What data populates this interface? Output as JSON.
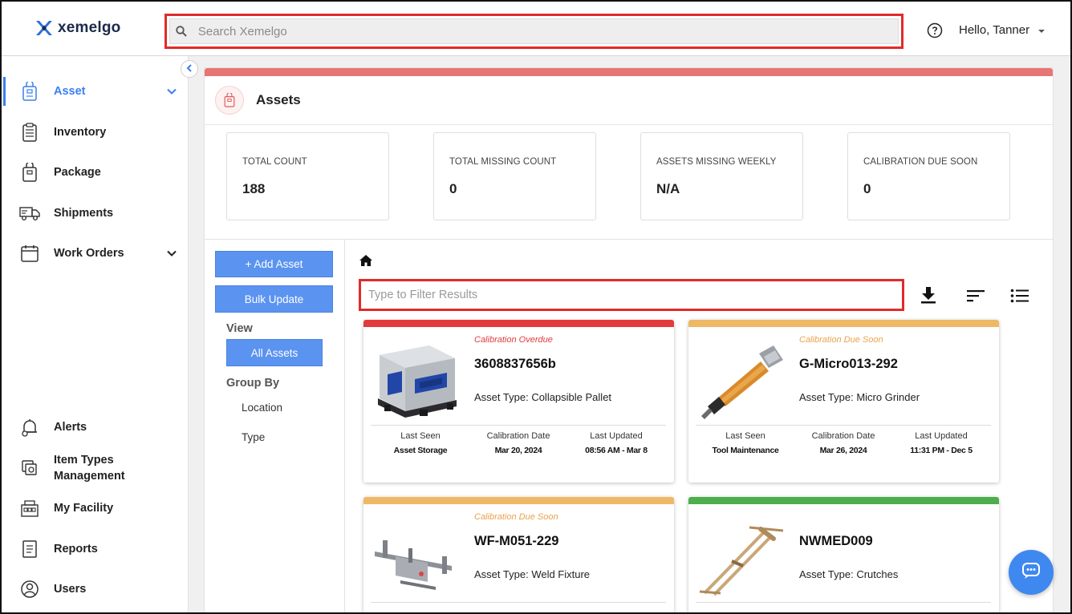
{
  "brand": {
    "name": "xemelgo"
  },
  "search": {
    "placeholder": "Search Xemelgo"
  },
  "user": {
    "greeting": "Hello, Tanner"
  },
  "sidebar": {
    "items": [
      {
        "label": "Asset",
        "icon": "asset-tag-icon",
        "active": true,
        "expandable": true
      },
      {
        "label": "Inventory",
        "icon": "inventory-clipboard-icon"
      },
      {
        "label": "Package",
        "icon": "package-tag-icon"
      },
      {
        "label": "Shipments",
        "icon": "truck-icon"
      },
      {
        "label": "Work Orders",
        "icon": "calendar-icon",
        "expandable": true
      },
      {
        "label": "Alerts",
        "icon": "bell-icon"
      },
      {
        "label": "Item Types Management",
        "label_line1": "Item Types",
        "label_line2": "Management",
        "icon": "item-types-icon"
      },
      {
        "label": "My Facility",
        "icon": "facility-icon"
      },
      {
        "label": "Reports",
        "icon": "report-icon"
      },
      {
        "label": "Users",
        "icon": "user-icon"
      }
    ]
  },
  "page": {
    "title": "Assets",
    "accent_color": "#e87575",
    "metrics": [
      {
        "label": "TOTAL COUNT",
        "value": "188"
      },
      {
        "label": "TOTAL MISSING COUNT",
        "value": "0"
      },
      {
        "label": "ASSETS MISSING WEEKLY",
        "value": "N/A"
      },
      {
        "label": "CALIBRATION DUE SOON",
        "value": "0"
      }
    ]
  },
  "actions": {
    "add_asset": "+ Add Asset",
    "bulk_update": "Bulk Update"
  },
  "view": {
    "heading": "View",
    "selected": "All Assets"
  },
  "group_by": {
    "heading": "Group By",
    "options": [
      "Location",
      "Type"
    ]
  },
  "filter": {
    "placeholder": "Type to Filter Results"
  },
  "toolbar": {
    "icons": [
      "download-icon",
      "sort-icon",
      "list-view-icon"
    ]
  },
  "cards": [
    {
      "status": "Calibration Overdue",
      "status_color": "#e23b3b",
      "bar_color": "#e23b3b",
      "id": "3608837656b",
      "type_label": "Asset Type:",
      "type": "Collapsible Pallet",
      "last_seen_label": "Last Seen",
      "last_seen": "Asset Storage",
      "calibration_label": "Calibration Date",
      "calibration": "Mar 20, 2024",
      "updated_label": "Last Updated",
      "updated": "08:56 AM - Mar 8"
    },
    {
      "status": "Calibration Due Soon",
      "status_color": "#eba24a",
      "bar_color": "#efb866",
      "id": "G-Micro013-292",
      "type_label": "Asset Type:",
      "type": "Micro Grinder",
      "last_seen_label": "Last Seen",
      "last_seen": "Tool Maintenance",
      "calibration_label": "Calibration Date",
      "calibration": "Mar 26, 2024",
      "updated_label": "Last Updated",
      "updated": "11:31 PM - Dec 5"
    },
    {
      "status": "Calibration Due Soon",
      "status_color": "#eba24a",
      "bar_color": "#efb866",
      "id": "WF-M051-229",
      "type_label": "Asset Type:",
      "type": "Weld Fixture"
    },
    {
      "status": "",
      "status_color": "#4cae4c",
      "bar_color": "#4cae4c",
      "id": "NWMED009",
      "type_label": "Asset Type:",
      "type": "Crutches"
    }
  ],
  "chat": {
    "icon": "chat-bubble-icon"
  }
}
